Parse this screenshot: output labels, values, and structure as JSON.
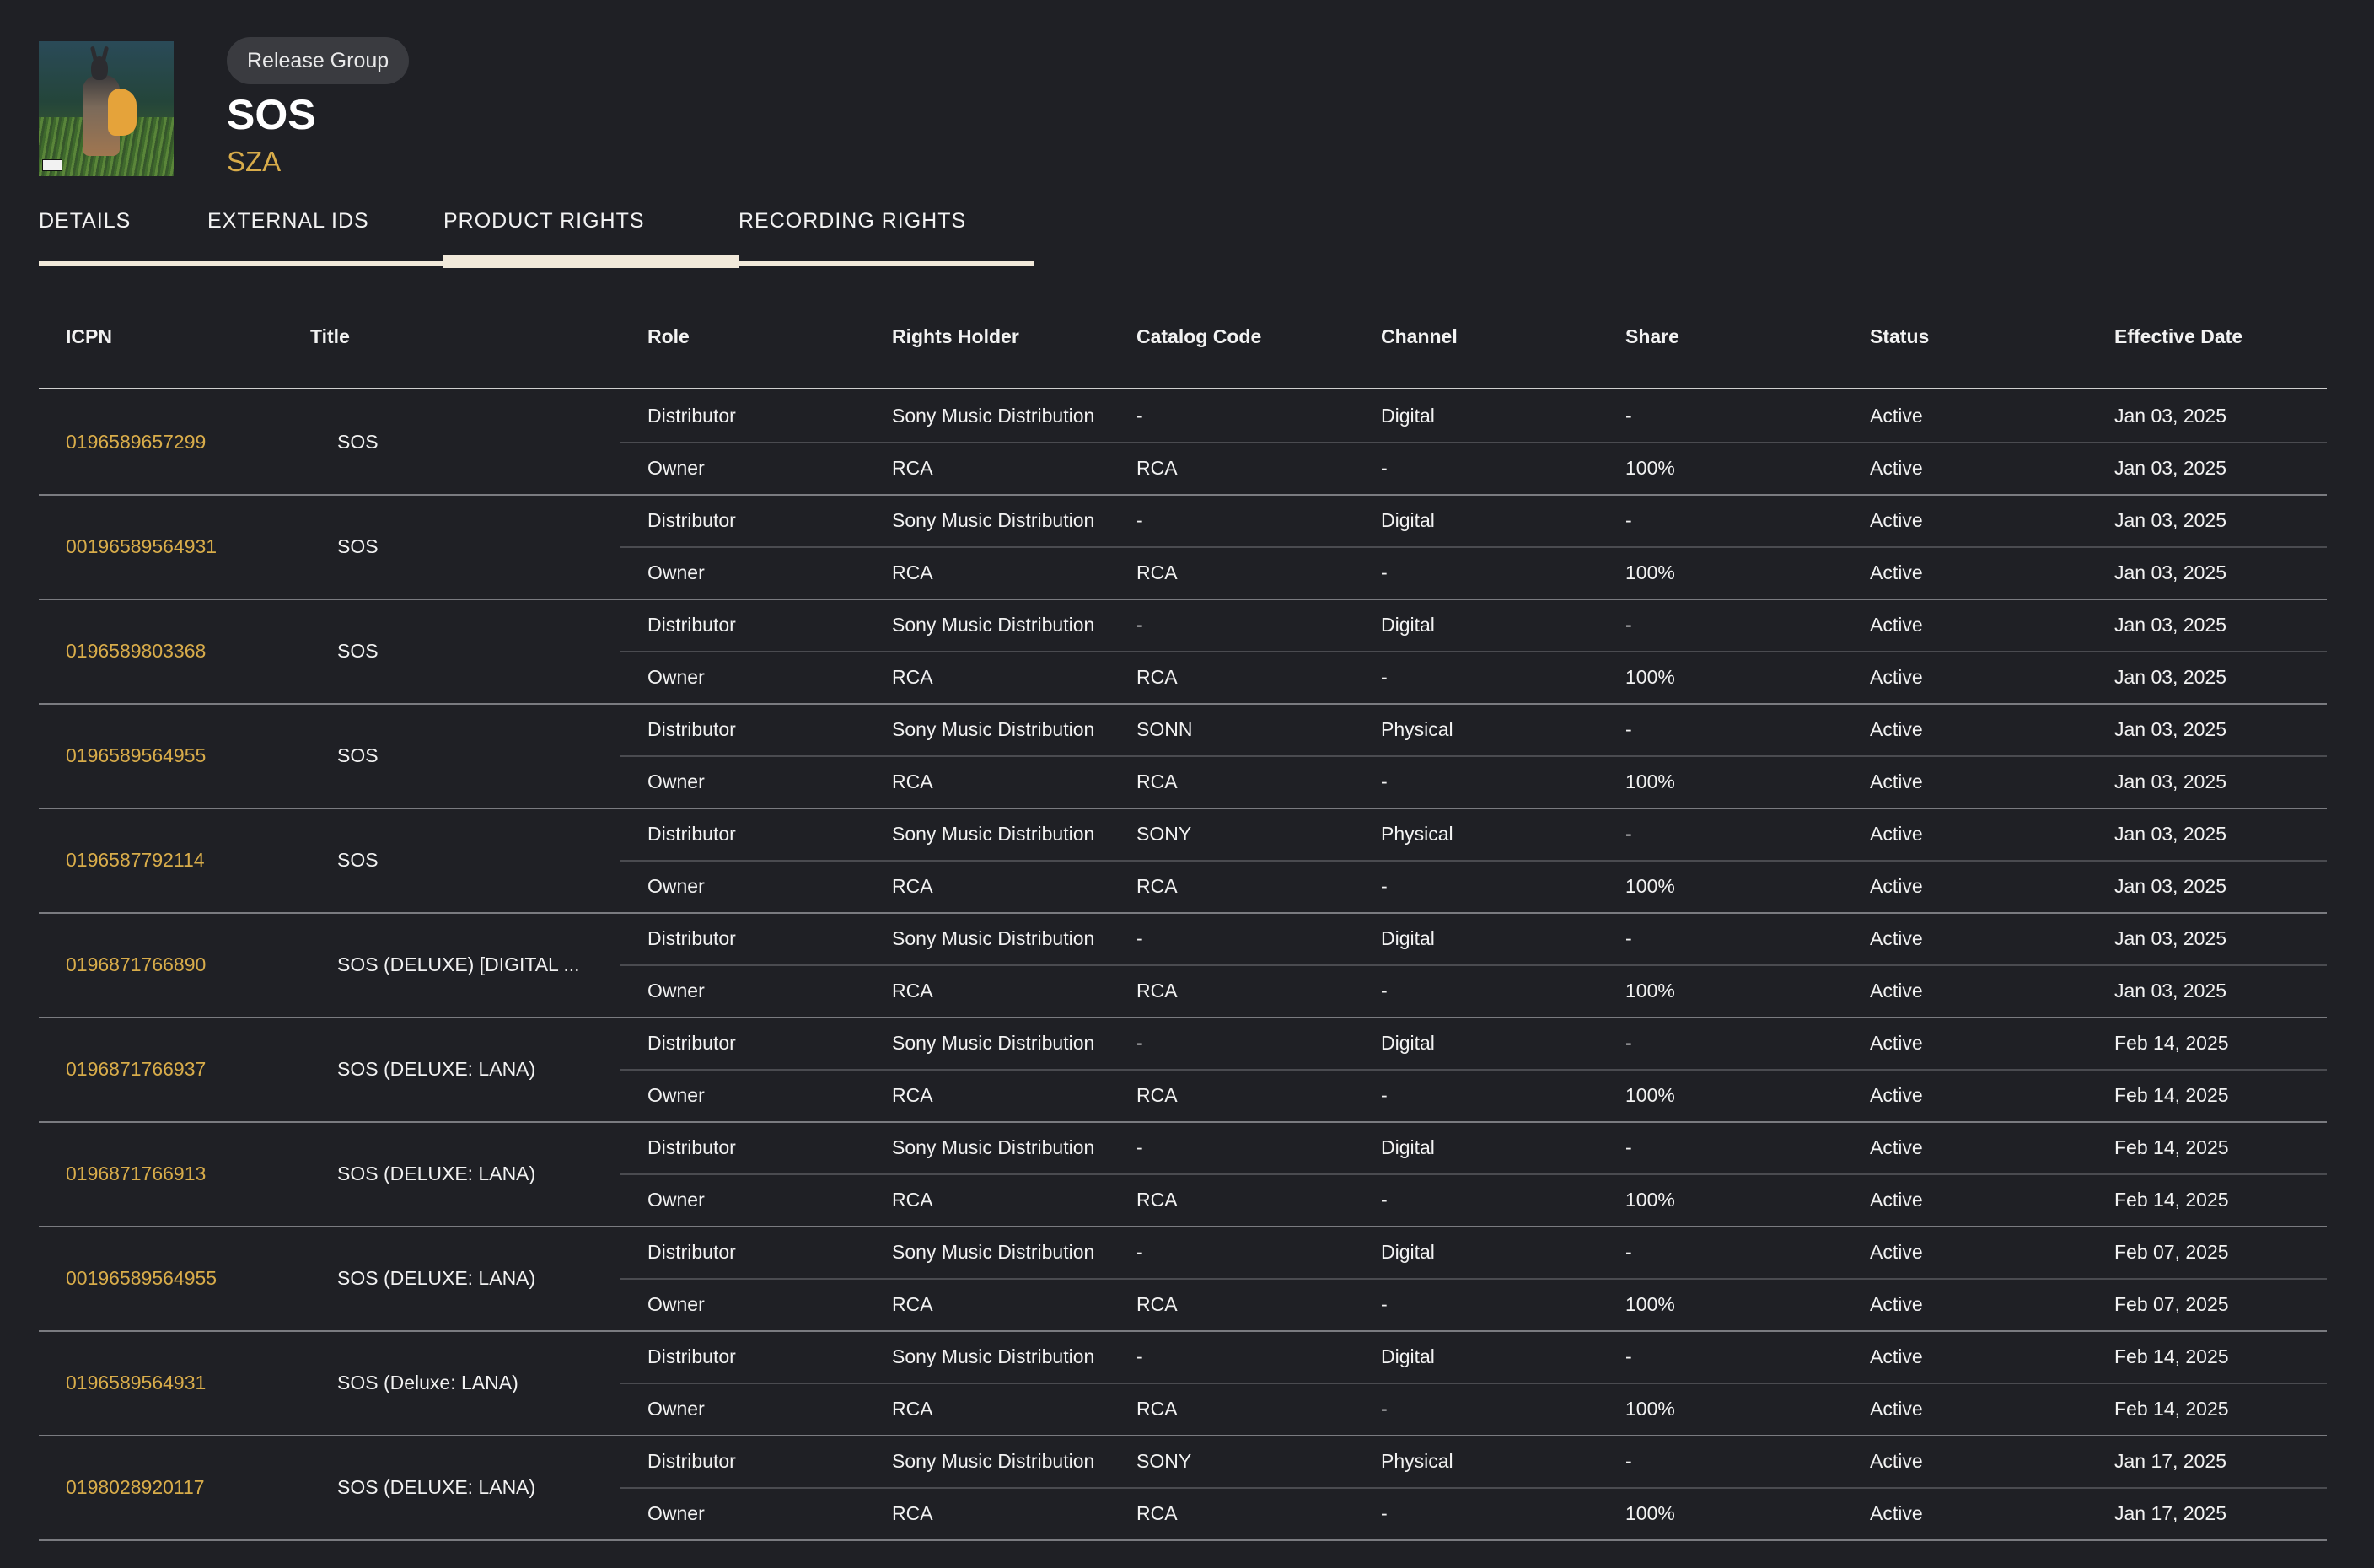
{
  "header": {
    "badge": "Release Group",
    "title": "SOS",
    "artist": "SZA",
    "cover_icon": "album-cover-image"
  },
  "tabs": [
    {
      "label": "DETAILS"
    },
    {
      "label": "EXTERNAL IDS"
    },
    {
      "label": "PRODUCT RIGHTS",
      "active": true
    },
    {
      "label": "RECORDING RIGHTS"
    }
  ],
  "table": {
    "columns": [
      "ICPN",
      "Title",
      "Role",
      "Rights Holder",
      "Catalog Code",
      "Channel",
      "Share",
      "Status",
      "Effective Date"
    ],
    "groups": [
      {
        "icpn": "0196589657299",
        "title": "SOS",
        "rows": [
          [
            "Distributor",
            "Sony Music Distribution",
            "-",
            "Digital",
            "-",
            "Active",
            "Jan 03, 2025"
          ],
          [
            "Owner",
            "RCA",
            "RCA",
            "-",
            "100%",
            "Active",
            "Jan 03, 2025"
          ]
        ]
      },
      {
        "icpn": "00196589564931",
        "title": "SOS",
        "rows": [
          [
            "Distributor",
            "Sony Music Distribution",
            "-",
            "Digital",
            "-",
            "Active",
            "Jan 03, 2025"
          ],
          [
            "Owner",
            "RCA",
            "RCA",
            "-",
            "100%",
            "Active",
            "Jan 03, 2025"
          ]
        ]
      },
      {
        "icpn": "0196589803368",
        "title": "SOS",
        "rows": [
          [
            "Distributor",
            "Sony Music Distribution",
            "-",
            "Digital",
            "-",
            "Active",
            "Jan 03, 2025"
          ],
          [
            "Owner",
            "RCA",
            "RCA",
            "-",
            "100%",
            "Active",
            "Jan 03, 2025"
          ]
        ]
      },
      {
        "icpn": "0196589564955",
        "title": "SOS",
        "rows": [
          [
            "Distributor",
            "Sony Music Distribution",
            "SONN",
            "Physical",
            "-",
            "Active",
            "Jan 03, 2025"
          ],
          [
            "Owner",
            "RCA",
            "RCA",
            "-",
            "100%",
            "Active",
            "Jan 03, 2025"
          ]
        ]
      },
      {
        "icpn": "0196587792114",
        "title": "SOS",
        "rows": [
          [
            "Distributor",
            "Sony Music Distribution",
            "SONY",
            "Physical",
            "-",
            "Active",
            "Jan 03, 2025"
          ],
          [
            "Owner",
            "RCA",
            "RCA",
            "-",
            "100%",
            "Active",
            "Jan 03, 2025"
          ]
        ]
      },
      {
        "icpn": "0196871766890",
        "title": "SOS (DELUXE) [DIGITAL ...",
        "rows": [
          [
            "Distributor",
            "Sony Music Distribution",
            "-",
            "Digital",
            "-",
            "Active",
            "Jan 03, 2025"
          ],
          [
            "Owner",
            "RCA",
            "RCA",
            "-",
            "100%",
            "Active",
            "Jan 03, 2025"
          ]
        ]
      },
      {
        "icpn": "0196871766937",
        "title": "SOS (DELUXE: LANA)",
        "rows": [
          [
            "Distributor",
            "Sony Music Distribution",
            "-",
            "Digital",
            "-",
            "Active",
            "Feb 14, 2025"
          ],
          [
            "Owner",
            "RCA",
            "RCA",
            "-",
            "100%",
            "Active",
            "Feb 14, 2025"
          ]
        ]
      },
      {
        "icpn": "0196871766913",
        "title": "SOS (DELUXE: LANA)",
        "rows": [
          [
            "Distributor",
            "Sony Music Distribution",
            "-",
            "Digital",
            "-",
            "Active",
            "Feb 14, 2025"
          ],
          [
            "Owner",
            "RCA",
            "RCA",
            "-",
            "100%",
            "Active",
            "Feb 14, 2025"
          ]
        ]
      },
      {
        "icpn": "00196589564955",
        "title": "SOS (DELUXE: LANA)",
        "rows": [
          [
            "Distributor",
            "Sony Music Distribution",
            "-",
            "Digital",
            "-",
            "Active",
            "Feb 07, 2025"
          ],
          [
            "Owner",
            "RCA",
            "RCA",
            "-",
            "100%",
            "Active",
            "Feb 07, 2025"
          ]
        ]
      },
      {
        "icpn": "0196589564931",
        "title": "SOS (Deluxe: LANA)",
        "rows": [
          [
            "Distributor",
            "Sony Music Distribution",
            "-",
            "Digital",
            "-",
            "Active",
            "Feb 14, 2025"
          ],
          [
            "Owner",
            "RCA",
            "RCA",
            "-",
            "100%",
            "Active",
            "Feb 14, 2025"
          ]
        ]
      },
      {
        "icpn": "0198028920117",
        "title": "SOS (DELUXE: LANA)",
        "rows": [
          [
            "Distributor",
            "Sony Music Distribution",
            "SONY",
            "Physical",
            "-",
            "Active",
            "Jan 17, 2025"
          ],
          [
            "Owner",
            "RCA",
            "RCA",
            "-",
            "100%",
            "Active",
            "Jan 17, 2025"
          ]
        ]
      }
    ]
  },
  "colors": {
    "background": "#1f2025",
    "accent_gold": "#d8ac4a",
    "tab_underline": "#f1e9da",
    "text": "#f2f2f2"
  }
}
